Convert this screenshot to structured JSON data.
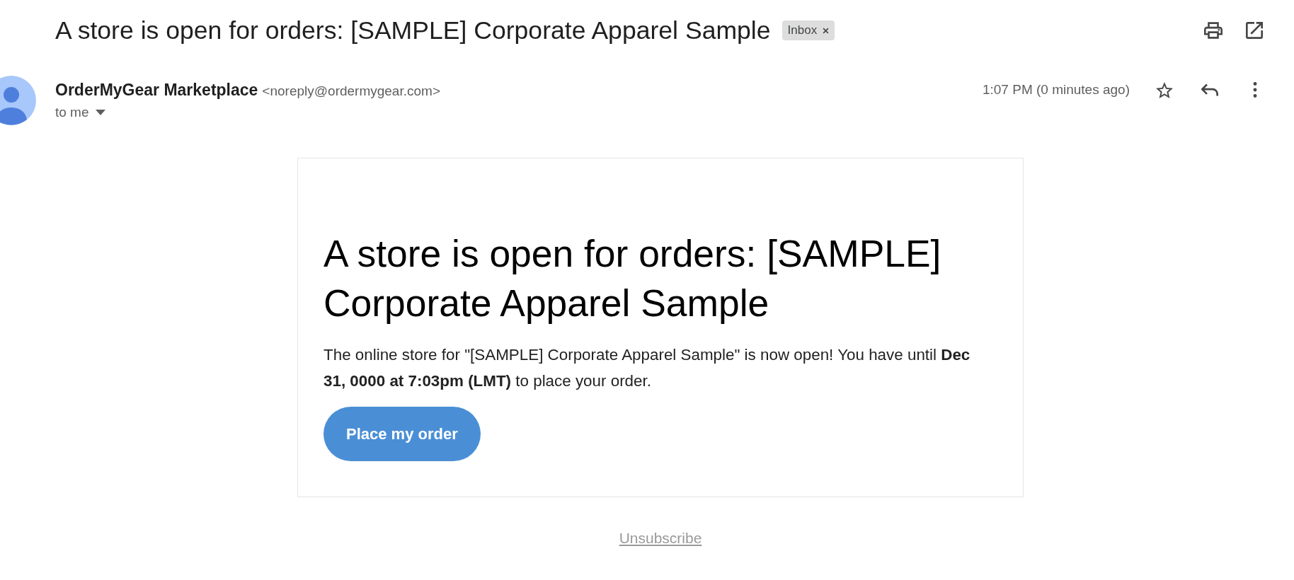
{
  "email": {
    "subject": "A store is open for orders: [SAMPLE] Corporate Apparel Sample",
    "labels": [
      {
        "label": "Inbox"
      }
    ]
  },
  "sender": {
    "name": "OrderMyGear Marketplace",
    "address": "<noreply@ordermygear.com>",
    "recipient": "to me",
    "time": "1:07 PM (0 minutes ago)",
    "starred": false
  },
  "message": {
    "heading": "A store is open for orders: [SAMPLE] Corporate Apparel Sample",
    "body": "The online store for \"[SAMPLE] Corporate Apparel Sample\" is now open! You have until **Dec 31, 0000 at 7:03pm (LMT)** to place your order.",
    "button": "Place my order",
    "footer_link": "Unsubscribe"
  }
}
